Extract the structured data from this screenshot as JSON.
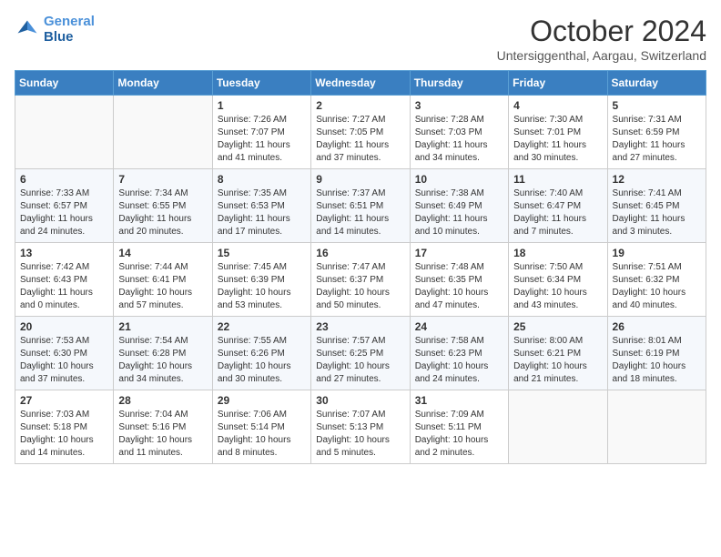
{
  "header": {
    "logo_line1": "General",
    "logo_line2": "Blue",
    "month_title": "October 2024",
    "location": "Untersiggenthal, Aargau, Switzerland"
  },
  "weekdays": [
    "Sunday",
    "Monday",
    "Tuesday",
    "Wednesday",
    "Thursday",
    "Friday",
    "Saturday"
  ],
  "weeks": [
    [
      {
        "day": "",
        "detail": ""
      },
      {
        "day": "",
        "detail": ""
      },
      {
        "day": "1",
        "detail": "Sunrise: 7:26 AM\nSunset: 7:07 PM\nDaylight: 11 hours and 41 minutes."
      },
      {
        "day": "2",
        "detail": "Sunrise: 7:27 AM\nSunset: 7:05 PM\nDaylight: 11 hours and 37 minutes."
      },
      {
        "day": "3",
        "detail": "Sunrise: 7:28 AM\nSunset: 7:03 PM\nDaylight: 11 hours and 34 minutes."
      },
      {
        "day": "4",
        "detail": "Sunrise: 7:30 AM\nSunset: 7:01 PM\nDaylight: 11 hours and 30 minutes."
      },
      {
        "day": "5",
        "detail": "Sunrise: 7:31 AM\nSunset: 6:59 PM\nDaylight: 11 hours and 27 minutes."
      }
    ],
    [
      {
        "day": "6",
        "detail": "Sunrise: 7:33 AM\nSunset: 6:57 PM\nDaylight: 11 hours and 24 minutes."
      },
      {
        "day": "7",
        "detail": "Sunrise: 7:34 AM\nSunset: 6:55 PM\nDaylight: 11 hours and 20 minutes."
      },
      {
        "day": "8",
        "detail": "Sunrise: 7:35 AM\nSunset: 6:53 PM\nDaylight: 11 hours and 17 minutes."
      },
      {
        "day": "9",
        "detail": "Sunrise: 7:37 AM\nSunset: 6:51 PM\nDaylight: 11 hours and 14 minutes."
      },
      {
        "day": "10",
        "detail": "Sunrise: 7:38 AM\nSunset: 6:49 PM\nDaylight: 11 hours and 10 minutes."
      },
      {
        "day": "11",
        "detail": "Sunrise: 7:40 AM\nSunset: 6:47 PM\nDaylight: 11 hours and 7 minutes."
      },
      {
        "day": "12",
        "detail": "Sunrise: 7:41 AM\nSunset: 6:45 PM\nDaylight: 11 hours and 3 minutes."
      }
    ],
    [
      {
        "day": "13",
        "detail": "Sunrise: 7:42 AM\nSunset: 6:43 PM\nDaylight: 11 hours and 0 minutes."
      },
      {
        "day": "14",
        "detail": "Sunrise: 7:44 AM\nSunset: 6:41 PM\nDaylight: 10 hours and 57 minutes."
      },
      {
        "day": "15",
        "detail": "Sunrise: 7:45 AM\nSunset: 6:39 PM\nDaylight: 10 hours and 53 minutes."
      },
      {
        "day": "16",
        "detail": "Sunrise: 7:47 AM\nSunset: 6:37 PM\nDaylight: 10 hours and 50 minutes."
      },
      {
        "day": "17",
        "detail": "Sunrise: 7:48 AM\nSunset: 6:35 PM\nDaylight: 10 hours and 47 minutes."
      },
      {
        "day": "18",
        "detail": "Sunrise: 7:50 AM\nSunset: 6:34 PM\nDaylight: 10 hours and 43 minutes."
      },
      {
        "day": "19",
        "detail": "Sunrise: 7:51 AM\nSunset: 6:32 PM\nDaylight: 10 hours and 40 minutes."
      }
    ],
    [
      {
        "day": "20",
        "detail": "Sunrise: 7:53 AM\nSunset: 6:30 PM\nDaylight: 10 hours and 37 minutes."
      },
      {
        "day": "21",
        "detail": "Sunrise: 7:54 AM\nSunset: 6:28 PM\nDaylight: 10 hours and 34 minutes."
      },
      {
        "day": "22",
        "detail": "Sunrise: 7:55 AM\nSunset: 6:26 PM\nDaylight: 10 hours and 30 minutes."
      },
      {
        "day": "23",
        "detail": "Sunrise: 7:57 AM\nSunset: 6:25 PM\nDaylight: 10 hours and 27 minutes."
      },
      {
        "day": "24",
        "detail": "Sunrise: 7:58 AM\nSunset: 6:23 PM\nDaylight: 10 hours and 24 minutes."
      },
      {
        "day": "25",
        "detail": "Sunrise: 8:00 AM\nSunset: 6:21 PM\nDaylight: 10 hours and 21 minutes."
      },
      {
        "day": "26",
        "detail": "Sunrise: 8:01 AM\nSunset: 6:19 PM\nDaylight: 10 hours and 18 minutes."
      }
    ],
    [
      {
        "day": "27",
        "detail": "Sunrise: 7:03 AM\nSunset: 5:18 PM\nDaylight: 10 hours and 14 minutes."
      },
      {
        "day": "28",
        "detail": "Sunrise: 7:04 AM\nSunset: 5:16 PM\nDaylight: 10 hours and 11 minutes."
      },
      {
        "day": "29",
        "detail": "Sunrise: 7:06 AM\nSunset: 5:14 PM\nDaylight: 10 hours and 8 minutes."
      },
      {
        "day": "30",
        "detail": "Sunrise: 7:07 AM\nSunset: 5:13 PM\nDaylight: 10 hours and 5 minutes."
      },
      {
        "day": "31",
        "detail": "Sunrise: 7:09 AM\nSunset: 5:11 PM\nDaylight: 10 hours and 2 minutes."
      },
      {
        "day": "",
        "detail": ""
      },
      {
        "day": "",
        "detail": ""
      }
    ]
  ]
}
